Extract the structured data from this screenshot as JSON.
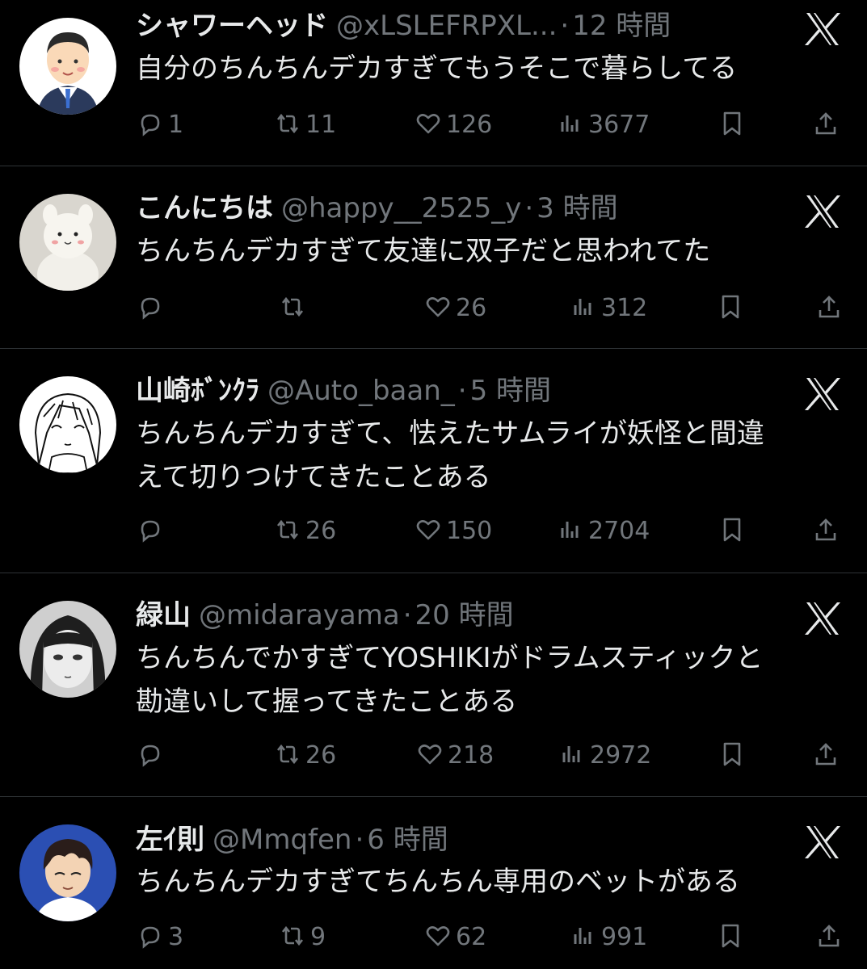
{
  "tweets": [
    {
      "name": "シャワーヘッド",
      "handle": "@xLSLEFRPXL...",
      "separator": "·",
      "time": "12 時間",
      "text_lines": [
        "自分のちんちんデカすぎてもうそこで暮らしてる"
      ],
      "replies": "1",
      "retweets": "11",
      "likes": "126",
      "views": "3677",
      "avatar": "businessman-illustration"
    },
    {
      "name": "こんにちは",
      "handle": "@happy__2525_y",
      "separator": "·",
      "time": "3 時間",
      "text_lines": [
        "ちんちんデカすぎて友達に双子だと思われてた"
      ],
      "replies": "",
      "retweets": "",
      "likes": "26",
      "views": "312",
      "avatar": "white-plush-toy"
    },
    {
      "name": "山崎ﾎﾞﾝｸﾗ",
      "handle": "@Auto_baan_",
      "separator": "·",
      "time": "5 時間",
      "text_lines": [
        "ちんちんデカすぎて、怯えたサムライが妖怪と間違",
        "えて切りつけてきたことある"
      ],
      "replies": "",
      "retweets": "26",
      "likes": "150",
      "views": "2704",
      "avatar": "anime-girl-sketch"
    },
    {
      "name": "緑山",
      "handle": "@midarayama",
      "separator": "·",
      "time": "20 時間",
      "text_lines": [
        "ちんちんでかすぎてYOSHIKIがドラムスティックと",
        "勘違いして握ってきたことある"
      ],
      "replies": "",
      "retweets": "26",
      "likes": "218",
      "views": "2972",
      "avatar": "manga-girl-portrait"
    },
    {
      "name": "左ｲ則",
      "handle": "@Mmqfen",
      "separator": "·",
      "time": "6 時間",
      "text_lines": [
        "ちんちんデカすぎてちんちん専用のベットがある"
      ],
      "replies": "3",
      "retweets": "9",
      "likes": "62",
      "views": "991",
      "avatar": "anime-boy-portrait"
    }
  ],
  "icons": {
    "reply": "reply-icon",
    "retweet": "retweet-icon",
    "like": "heart-icon",
    "views": "views-icon",
    "bookmark": "bookmark-icon",
    "share": "share-icon",
    "brand": "x-logo-icon"
  },
  "colors": {
    "background": "#000000",
    "text": "#e7e9ea",
    "secondary": "#71767b",
    "divider": "#2f3336"
  }
}
